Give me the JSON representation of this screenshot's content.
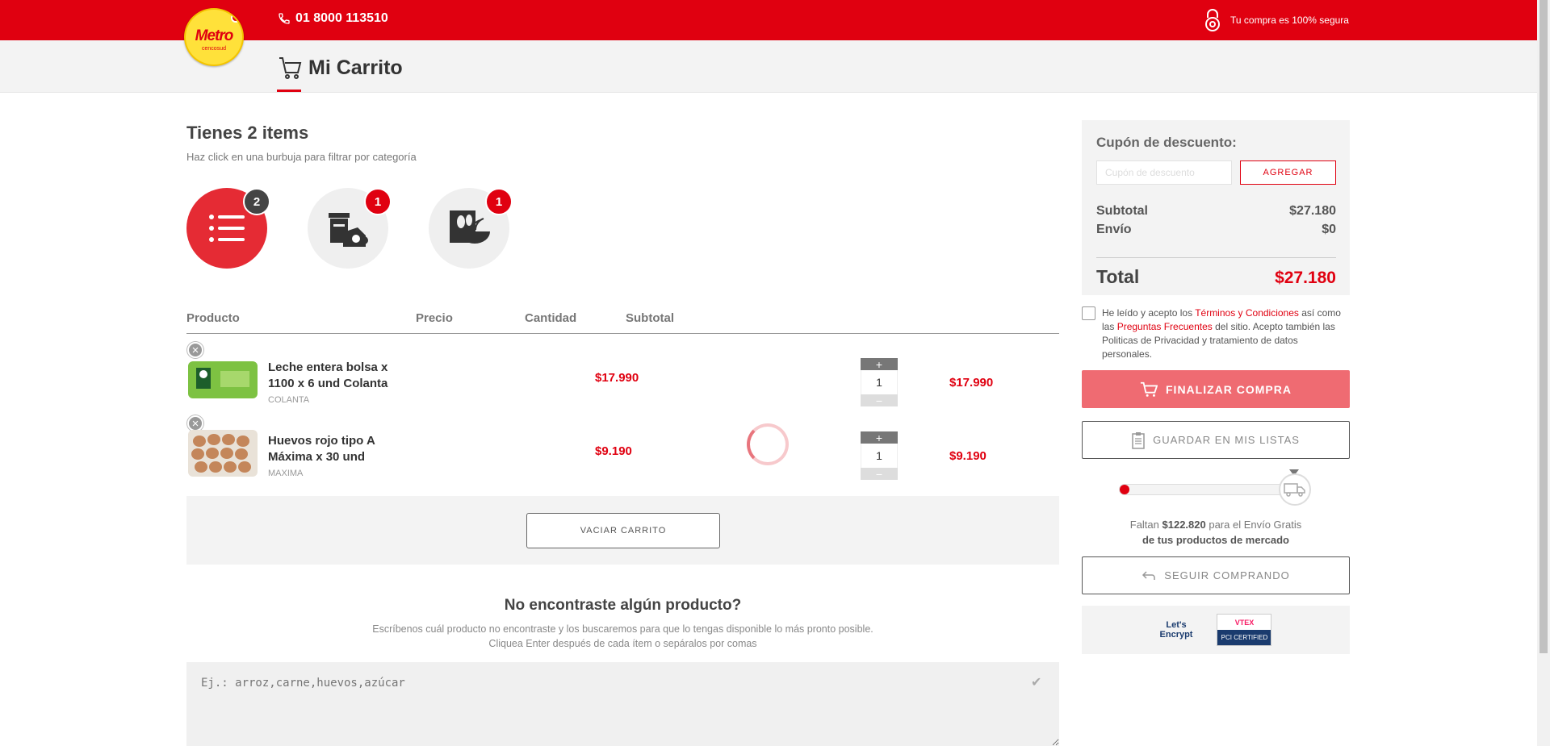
{
  "header": {
    "logo_text": "Metro",
    "logo_sub": "cencosud",
    "phone": "01 8000 113510",
    "secure_text": "Tu compra es 100% segura",
    "page_title": "Mi Carrito"
  },
  "cart": {
    "heading": "Tienes 2 items",
    "hint": "Haz click en una burbuja para filtrar por categoría",
    "bubbles": [
      {
        "icon": "list-icon",
        "count": "2"
      },
      {
        "icon": "dairy-eggs-icon",
        "count": "1"
      },
      {
        "icon": "cereal-bowl-icon",
        "count": "1"
      }
    ],
    "columns": {
      "product": "Producto",
      "price": "Precio",
      "quantity": "Cantidad",
      "subtotal": "Subtotal"
    },
    "items": [
      {
        "name": "Leche entera bolsa x 1100 x 6 und Colanta",
        "brand": "COLANTA",
        "price": "$17.990",
        "quantity": "1",
        "subtotal": "$17.990"
      },
      {
        "name": "Huevos rojo tipo A Máxima x 30 und",
        "brand": "MAXIMA",
        "price": "$9.190",
        "quantity": "1",
        "subtotal": "$9.190"
      }
    ],
    "empty_button": "VACIAR CARRITO"
  },
  "not_found": {
    "title": "No encontraste algún producto?",
    "line1": "Escríbenos cuál producto no encontraste y los buscaremos para que lo tengas disponible lo más pronto posible.",
    "line2": "Cliquea Enter después de cada ítem o sepáralos por comas",
    "placeholder": "Ej.: arroz,carne,huevos,azúcar"
  },
  "summary": {
    "coupon_label": "Cupón de descuento:",
    "coupon_placeholder": "Cupón de descuento",
    "coupon_button": "AGREGAR",
    "subtotal_label": "Subtotal",
    "subtotal_value": "$27.180",
    "shipping_label": "Envío",
    "shipping_value": "$0",
    "total_label": "Total",
    "total_value": "$27.180",
    "terms_pre": "He leído y acepto los ",
    "terms_link1": "Términos y Condiciones",
    "terms_mid": " así como las ",
    "terms_link2": "Preguntas Frecuentes",
    "terms_post": " del sitio. Acepto también las Politicas de Privacidad y tratamiento de datos personales.",
    "finalize_button": "FINALIZAR COMPRA",
    "save_list_button": "GUARDAR EN MIS LISTAS",
    "free_shipping_progress": 0.02,
    "shipping_msg_pre": "Faltan ",
    "shipping_msg_amount": "$122.820",
    "shipping_msg_post": " para el Envío Gratis",
    "shipping_msg_line2": "de tus productos de mercado",
    "continue_button": "SEGUIR COMPRANDO",
    "cert_le_line1": "Let's",
    "cert_le_line2": "Encrypt",
    "cert_vtex_top": "VTEX",
    "cert_vtex_bottom": "PCI CERTIFIED"
  },
  "colors": {
    "brand_red": "#e00010",
    "accent_red": "#e52b34",
    "button_disabled": "#ef6b72"
  }
}
